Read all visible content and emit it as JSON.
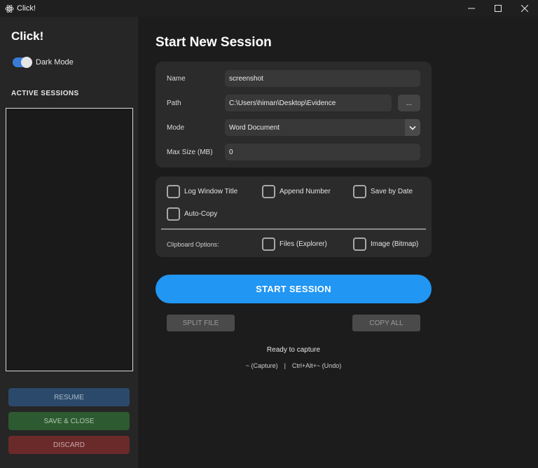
{
  "window": {
    "title": "Click!"
  },
  "sidebar": {
    "brand": "Click!",
    "dark_mode_label": "Dark Mode",
    "dark_mode_on": true,
    "sessions_heading": "ACTIVE SESSIONS",
    "active_sessions": [],
    "resume_label": "RESUME",
    "save_close_label": "SAVE & CLOSE",
    "discard_label": "DISCARD"
  },
  "main": {
    "title": "Start New Session",
    "form": {
      "name_label": "Name",
      "name_value": "screenshot",
      "path_label": "Path",
      "path_value": "C:\\Users\\himan\\Desktop\\Evidence",
      "browse_label": "...",
      "mode_label": "Mode",
      "mode_value": "Word Document",
      "max_size_label": "Max Size (MB)",
      "max_size_value": "0"
    },
    "options": {
      "log_window_title": "Log Window Title",
      "append_number": "Append Number",
      "save_by_date": "Save by Date",
      "auto_copy": "Auto-Copy",
      "clipboard_label": "Clipboard Options:",
      "files_explorer": "Files (Explorer)",
      "image_bitmap": "Image (Bitmap)"
    },
    "start_label": "START SESSION",
    "split_label": "SPLIT FILE",
    "copy_all_label": "COPY ALL",
    "status": "Ready to capture",
    "hotkey_capture": "~ (Capture)",
    "hotkey_sep": "|",
    "hotkey_undo": "Ctrl+Alt+~ (Undo)"
  },
  "colors": {
    "accent": "#2196f3",
    "toggle": "#3a7bd5",
    "resume": "#2b4a6b",
    "save": "#2d5a30",
    "discard": "#6b2a2a"
  },
  "icons": [
    "app-atom-icon",
    "minimize-icon",
    "maximize-icon",
    "close-icon",
    "chevron-down-icon"
  ]
}
